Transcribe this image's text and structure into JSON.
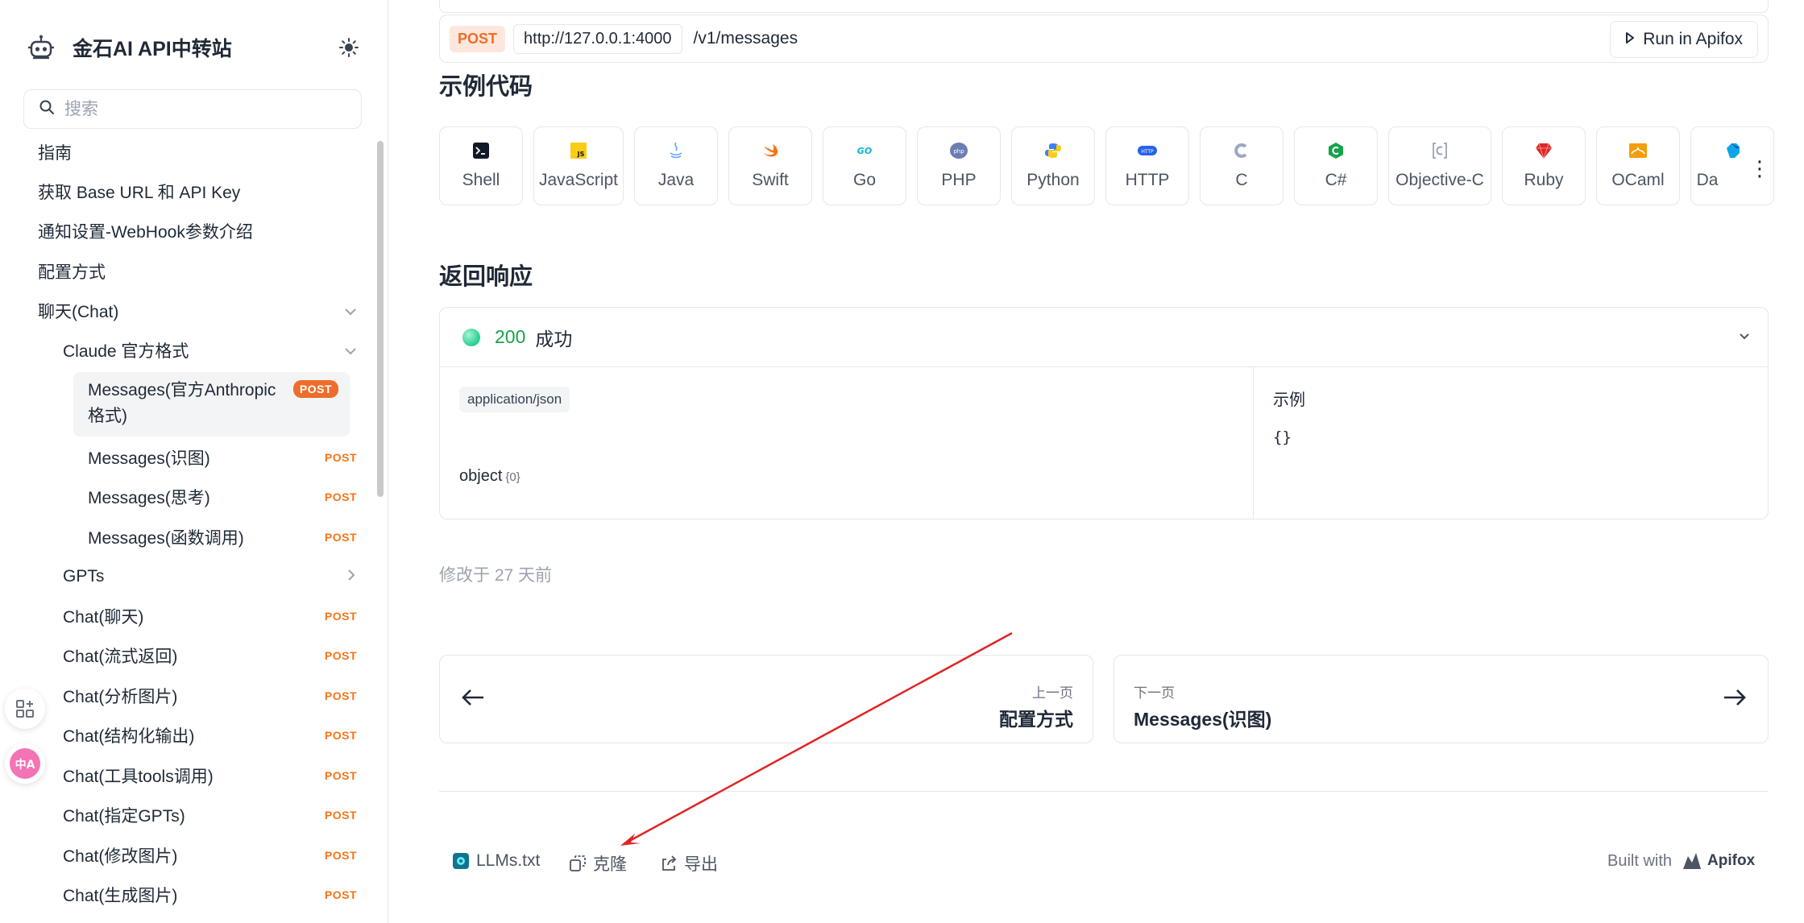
{
  "sidebar": {
    "brand": "金石AI API中转站",
    "search_placeholder": "搜索",
    "items": [
      {
        "label": "指南"
      },
      {
        "label": "获取 Base URL 和 API Key"
      },
      {
        "label": "通知设置-WebHook参数介绍"
      },
      {
        "label": "配置方式"
      },
      {
        "label": "聊天(Chat)"
      },
      {
        "label": "Claude 官方格式"
      },
      {
        "label": "Messages(官方Anthropic",
        "label2": "格式)",
        "badge": "POST"
      },
      {
        "label": "Messages(识图)",
        "badge": "POST"
      },
      {
        "label": "Messages(思考)",
        "badge": "POST"
      },
      {
        "label": "Messages(函数调用)",
        "badge": "POST"
      },
      {
        "label": "GPTs"
      },
      {
        "label": "Chat(聊天)",
        "badge": "POST"
      },
      {
        "label": "Chat(流式返回)",
        "badge": "POST"
      },
      {
        "label": "Chat(分析图片)",
        "badge": "POST"
      },
      {
        "label": "Chat(结构化输出)",
        "badge": "POST"
      },
      {
        "label": "Chat(工具tools调用)",
        "badge": "POST"
      },
      {
        "label": "Chat(指定GPTs)",
        "badge": "POST"
      },
      {
        "label": "Chat(修改图片)",
        "badge": "POST"
      },
      {
        "label": "Chat(生成图片)",
        "badge": "POST"
      }
    ]
  },
  "request": {
    "method": "POST",
    "host": "http://127.0.0.1:4000",
    "path": "/v1/messages",
    "run_label": "Run in Apifox"
  },
  "code_samples": {
    "title": "示例代码",
    "languages": [
      "Shell",
      "JavaScript",
      "Java",
      "Swift",
      "Go",
      "PHP",
      "Python",
      "HTTP",
      "C",
      "C#",
      "Objective-C",
      "Ruby",
      "OCaml",
      "Da"
    ]
  },
  "response": {
    "title": "返回响应",
    "status_code": "200",
    "status_text": "成功",
    "content_type": "application/json",
    "schema_type": "object",
    "schema_count": "{0}",
    "example_label": "示例",
    "example_value": "{}"
  },
  "modified": "修改于 27 天前",
  "pager": {
    "prev_small": "上一页",
    "prev_title": "配置方式",
    "next_small": "下一页",
    "next_title": "Messages(识图)"
  },
  "footer": {
    "llms": "LLMs.txt",
    "clone": "克隆",
    "export": "导出",
    "built_with": "Built with",
    "brand": "Apifox"
  },
  "colors": {
    "accent": "#ef6c2b",
    "success": "#16a34a",
    "annotation_arrow": "#e02424"
  }
}
